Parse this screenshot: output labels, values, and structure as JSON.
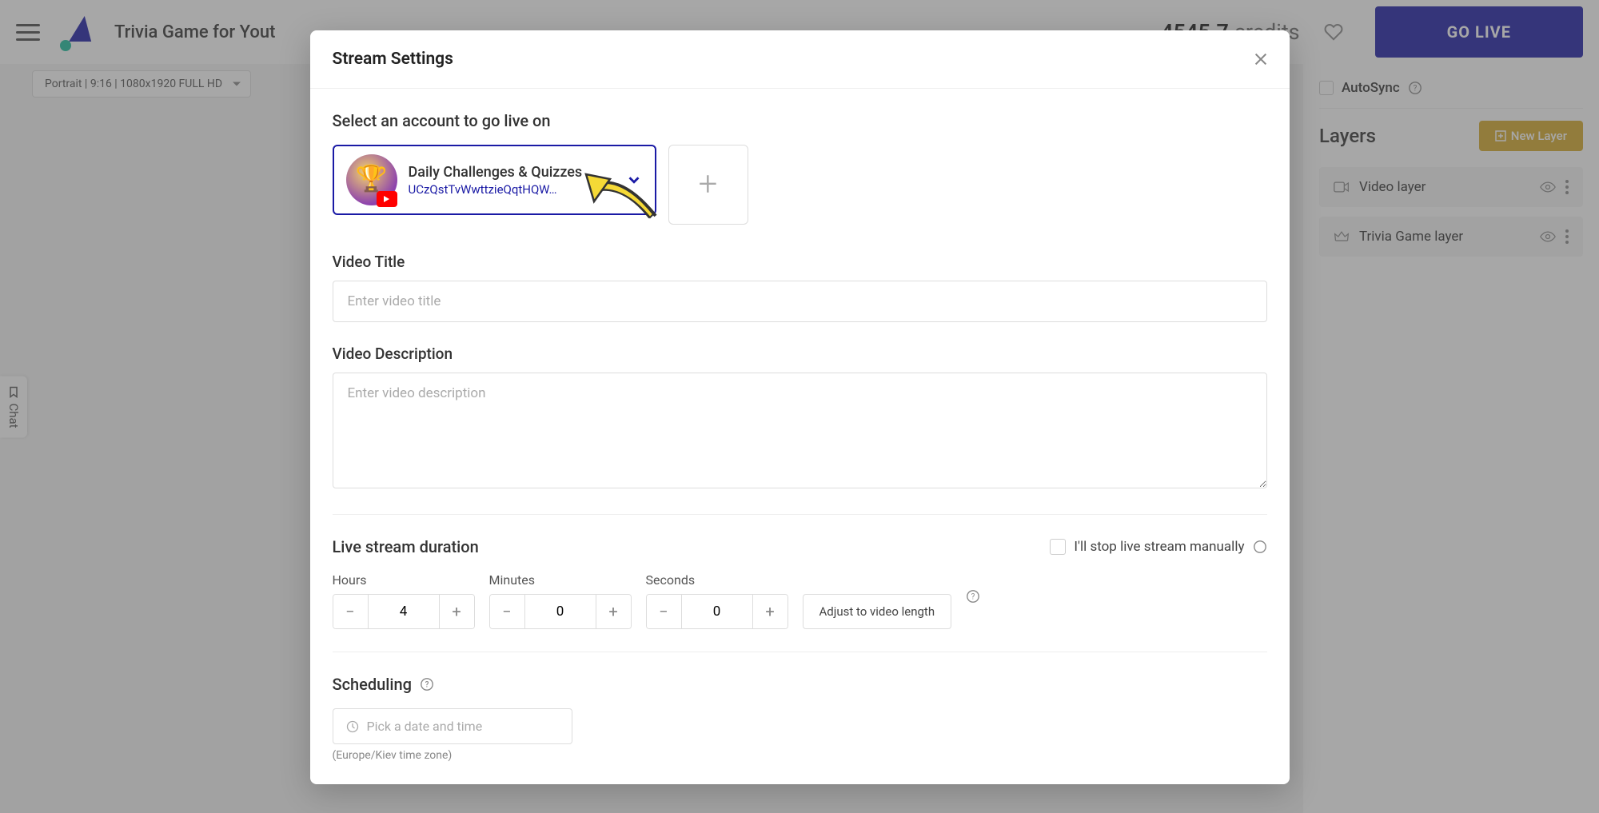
{
  "header": {
    "project_title": "Trivia Game for Yout",
    "credits_value": "4545.7",
    "credits_label": "credits",
    "go_live": "GO LIVE"
  },
  "toolbar": {
    "resolution": "Portrait | 9:16 | 1080x1920 FULL HD"
  },
  "sidebar": {
    "autosync": "AutoSync",
    "layers_title": "Layers",
    "new_layer": "New Layer",
    "layers": [
      {
        "name": "Video layer"
      },
      {
        "name": "Trivia Game layer"
      }
    ]
  },
  "chat_tab": "Chat",
  "modal": {
    "title": "Stream Settings",
    "select_account_label": "Select an account to go live on",
    "account": {
      "name": "Daily Challenges & Quizzes",
      "id": "UCzQstTvWwttzieQqtHQW…"
    },
    "video_title_label": "Video Title",
    "video_title_placeholder": "Enter video title",
    "video_desc_label": "Video Description",
    "video_desc_placeholder": "Enter video description",
    "duration_label": "Live stream duration",
    "manual_stop": "I'll stop live stream manually",
    "hours_label": "Hours",
    "minutes_label": "Minutes",
    "seconds_label": "Seconds",
    "hours_value": "4",
    "minutes_value": "0",
    "seconds_value": "0",
    "adjust_btn": "Adjust to video length",
    "scheduling_label": "Scheduling",
    "date_placeholder": "Pick a date and time",
    "tz_note": "(Europe/Kiev time zone)"
  }
}
